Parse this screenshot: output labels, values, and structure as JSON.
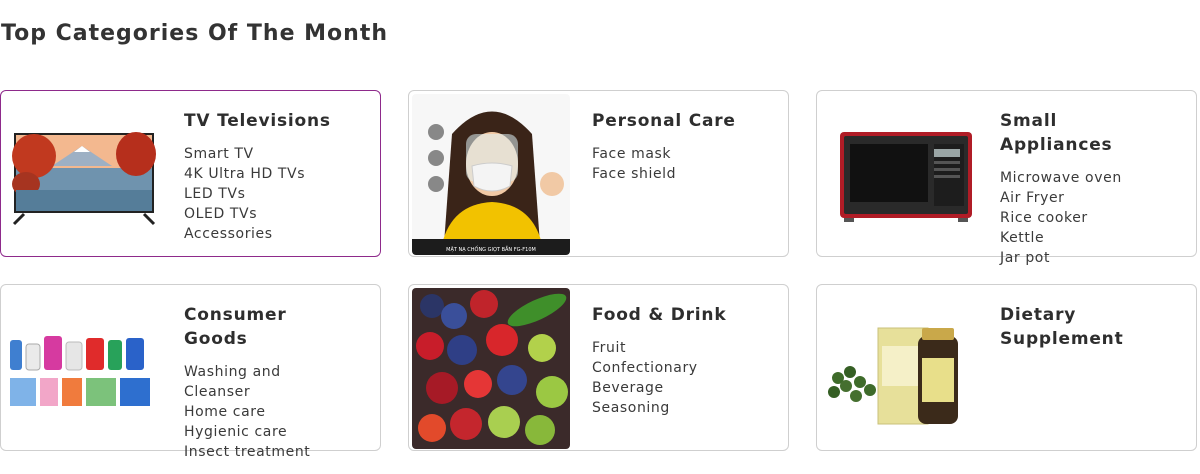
{
  "section_title": "Top Categories Of The Month",
  "categories": [
    {
      "name": "TV Televisions",
      "items": [
        "Smart TV",
        "4K Ultra HD TVs",
        "LED TVs",
        "OLED TVs",
        "Accessories"
      ],
      "image": "television-image",
      "active": true
    },
    {
      "name": "Personal Care",
      "items": [
        "Face mask",
        "Face shield"
      ],
      "image": "face-shield-image",
      "image_caption": "MẶT NẠ CHỐNG GIỌT BẮN FG-F10M"
    },
    {
      "name": "Small Appliances",
      "items": [
        "Microwave oven",
        "Air Fryer",
        "Rice cooker",
        "Kettle",
        "Jar pot"
      ],
      "image": "microwave-image"
    },
    {
      "name": "Consumer Goods",
      "items": [
        "Washing and Cleanser",
        "Home care",
        "Hygienic care",
        "Insect treatment"
      ],
      "image": "detergent-products-image"
    },
    {
      "name": "Food & Drink",
      "items": [
        "Fruit",
        "Confectionary",
        "Beverage",
        "Seasoning"
      ],
      "image": "fruits-image"
    },
    {
      "name": "Dietary Supplement",
      "items": [],
      "image": "supplement-bottle-image"
    }
  ],
  "colors": {
    "active_border": "#8e2a8b",
    "border": "#cfcfcf",
    "text": "#2e2e2e"
  }
}
